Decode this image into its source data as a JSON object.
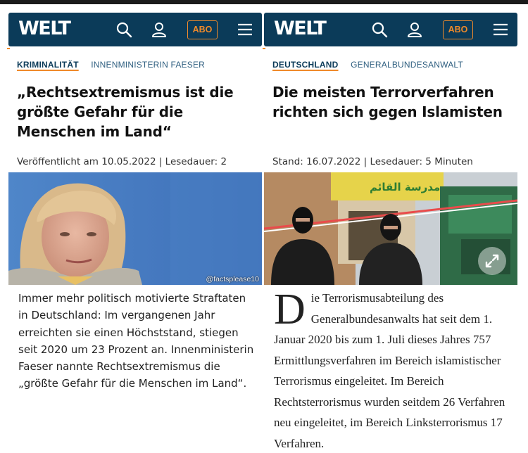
{
  "articles": [
    {
      "logo": "WELT",
      "abo_label": "ABO",
      "tag_main": "KRIMINALITÄT",
      "tag_sub": "INNENMINISTERIN FAESER",
      "headline": "„Rechtsextremismus ist die größte Gefahr für die Menschen im Land“",
      "meta": "Veröffentlicht am 10.05.2022 | Lesedauer: 2",
      "photo_credit": "@factsplease10",
      "text": "Immer mehr politisch motivierte Straftaten in Deutschland: Im vergangenen Jahr erreichten sie einen Höchststand, stiegen seit 2020 um 23 Prozent an. Innenministerin Faeser nannte Rechtsextremismus die „größte Gefahr für die Menschen im Land“."
    },
    {
      "logo": "WELT",
      "abo_label": "ABO",
      "tag_main": "DEUTSCHLAND",
      "tag_sub": "GENERALBUNDESANWALT",
      "headline": "Die meisten Terrorverfahren richten sich gegen Islamisten",
      "meta": "Stand: 16.07.2022 | Lesedauer: 5 Minuten",
      "sign_text": "مدرسة القائم",
      "dropcap": "D",
      "text": "ie Terrorismusabteilung des Generalbundesanwalts hat seit dem 1. Januar 2020 bis zum 1. Juli dieses Jahres 757 Ermittlungsverfahren im Bereich islamistischer Terrorismus eingeleitet. Im Bereich Rechtsterrorismus wurden seitdem 26 Verfahren neu eingeleitet, im Bereich Linksterrorismus 17 Verfahren."
    }
  ],
  "icons": [
    "search-icon",
    "user-icon",
    "menu-icon",
    "expand-icon"
  ],
  "colors": {
    "header": "#0b3b59",
    "accent": "#f08a2a",
    "background": "#ffffff"
  }
}
